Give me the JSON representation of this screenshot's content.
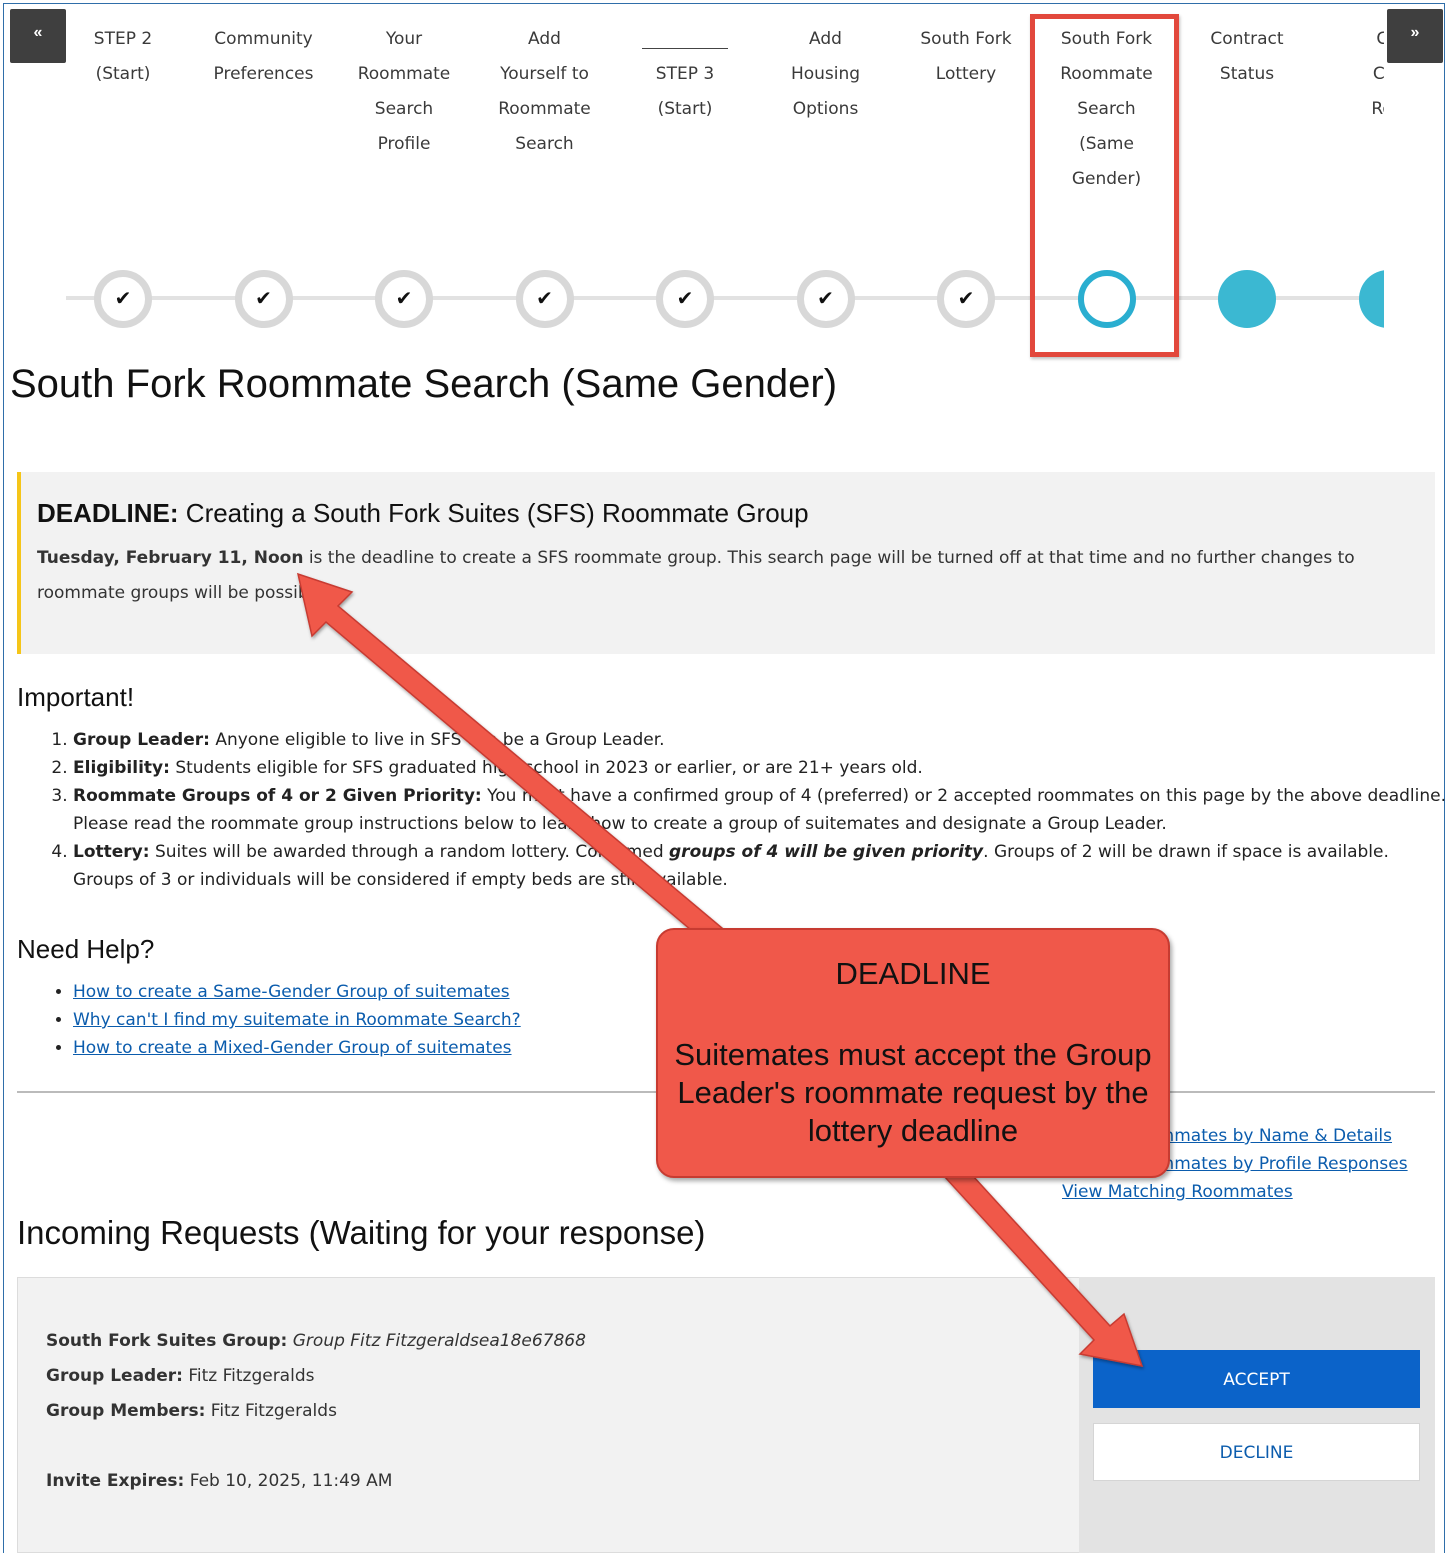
{
  "nav": {
    "prev_label": "«",
    "next_label": "»"
  },
  "steps": [
    {
      "label": "STEP 2 (Start)",
      "status": "complete"
    },
    {
      "label": "Community Preferences",
      "status": "complete"
    },
    {
      "label": "Your Roommate Search Profile",
      "status": "complete"
    },
    {
      "label": "Add Yourself to Roommate Search",
      "status": "complete"
    },
    {
      "label": "STEP 3 (Start)",
      "status": "complete"
    },
    {
      "label": "Add Housing Options",
      "status": "complete"
    },
    {
      "label": "South Fork Lottery",
      "status": "complete"
    },
    {
      "label": "South Fork Roommate Search (Same Gender)",
      "status": "current"
    },
    {
      "label": "Contract Status",
      "status": "upcoming"
    },
    {
      "label": "Ca Cor Req",
      "status": "upcoming"
    }
  ],
  "page_title": "South Fork Roommate Search (Same Gender)",
  "deadline": {
    "title_bold": "DEADLINE:",
    "title_rest": " Creating a South Fork Suites (SFS) Roommate Group",
    "date_bold": "Tuesday, February 11, Noon",
    "text": " is the deadline to create a SFS roommate group. This search page will be turned off at that time and no further changes to roommate groups will be possible."
  },
  "important": {
    "heading": "Important!",
    "items": [
      {
        "bold": "Group Leader:",
        "text": " Anyone eligible to live in SFS can be a Group Leader."
      },
      {
        "bold": "Eligibility:",
        "text": " Students eligible for SFS graduated high school in 2023 or earlier, or are 21+ years old."
      },
      {
        "bold": "Roommate Groups of 4 or 2 Given Priority:",
        "text": " You must have a confirmed group of 4 (preferred) or 2 accepted roommates on this page by the above deadline. Please read the roommate group instructions below to learn how to create a group of suitemates and designate a Group Leader."
      },
      {
        "bold": "Lottery:",
        "text_a": " Suites will be awarded through a random lottery. Confirmed ",
        "bold_italic": "groups of 4 will be given priority",
        "text_b": ". Groups of 2 will be drawn if space is available. Groups of 3 or individuals will be considered if empty beds are still available."
      }
    ]
  },
  "help": {
    "heading": "Need Help?",
    "links": [
      "How to create a Same-Gender Group of suitemates",
      "Why can't I find my suitemate in Roommate Search?",
      "How to create a Mixed-Gender Group of suitemates"
    ]
  },
  "search_links": [
    "Search Roommates by Name & Details",
    "Search Roommates by Profile Responses",
    "View Matching Roommates"
  ],
  "incoming": {
    "heading": "Incoming Requests (Waiting for your response)",
    "group_label": "South Fork Suites Group:",
    "group_value": "Group Fitz Fitzgeraldsea18e67868",
    "leader_label": "Group Leader:",
    "leader_value": "Fitz Fitzgeralds",
    "members_label": "Group Members:",
    "members_value": "Fitz Fitzgeralds",
    "expires_label": "Invite Expires:",
    "expires_value": "Feb 10, 2025, 11:49 AM",
    "accept_label": "ACCEPT",
    "decline_label": "DECLINE"
  },
  "annotation": {
    "title": "DEADLINE",
    "body": "Suitemates must accept the Group Leader's roommate request by the lottery deadline"
  },
  "colors": {
    "accent_blue": "#0b63c9",
    "progress_teal": "#2aaed0",
    "callout_red": "#f0584a",
    "deadline_bar": "#f5c518"
  }
}
